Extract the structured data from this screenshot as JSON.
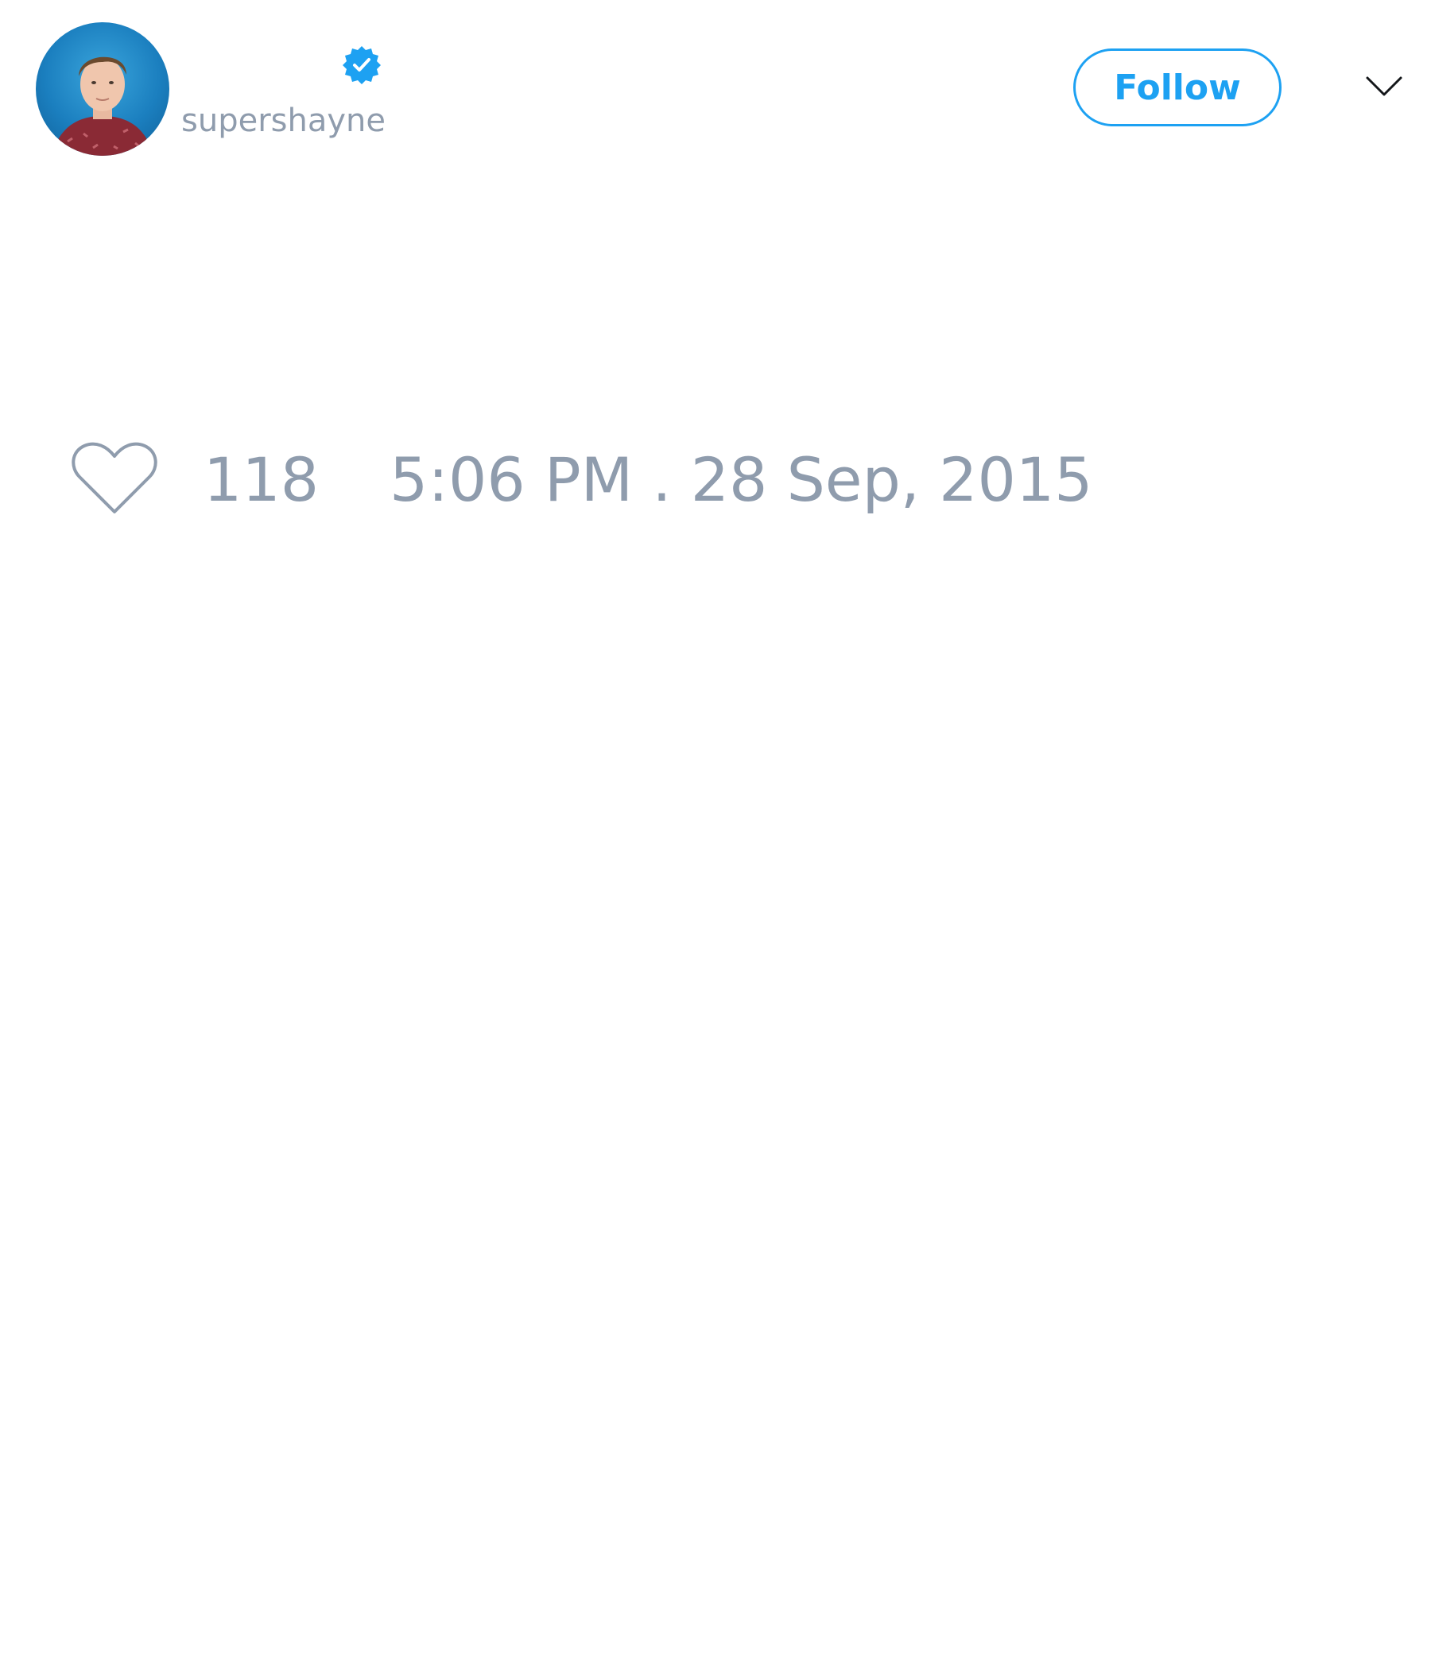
{
  "tweet": {
    "author": {
      "display_name": "",
      "handle": "supershayne",
      "verified": true
    },
    "follow_label": "Follow",
    "likes": "118",
    "timestamp": "5:06 PM . 28 Sep, 2015"
  },
  "icons": {
    "avatar": "avatar",
    "verified": "verified-badge-icon",
    "menu": "chevron-down-icon",
    "like": "heart-icon"
  },
  "colors": {
    "accent": "#1da1f2",
    "muted": "#8f9cad",
    "text": "#14171a",
    "background": "#ffffff"
  }
}
